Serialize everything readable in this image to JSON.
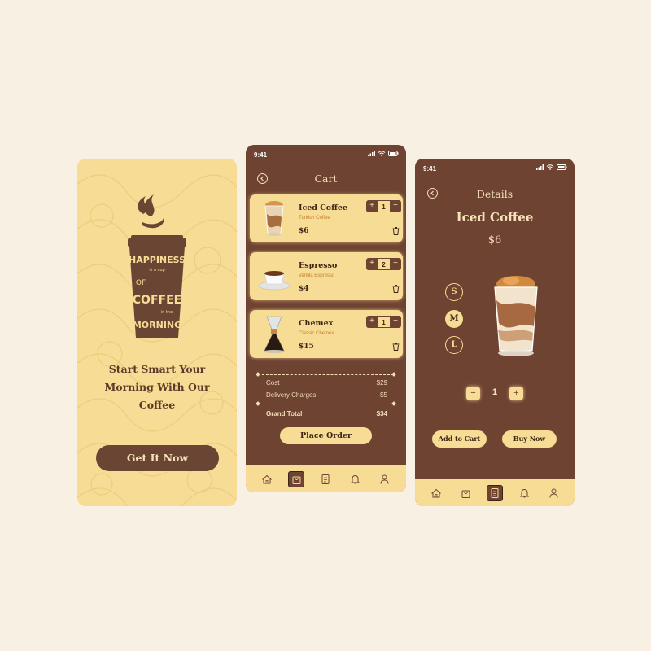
{
  "splash": {
    "logo_words": [
      "HAPPINESS",
      "is a cup",
      "OF",
      "COFFEE",
      "in the",
      "MORNING"
    ],
    "headline": [
      "Start Smart Your",
      "Morning With Our",
      "Coffee"
    ],
    "cta_label": "Get It Now"
  },
  "cart": {
    "status_time": "9:41",
    "title": "Cart",
    "items": [
      {
        "name": "Iced Coffee",
        "variant": "Turkish Coffee",
        "price": "$6",
        "qty": "1"
      },
      {
        "name": "Espresso",
        "variant": "Vanilla Espresso",
        "price": "$4",
        "qty": "2"
      },
      {
        "name": "Chemex",
        "variant": "Classic Chemex",
        "price": "$15",
        "qty": "1"
      }
    ],
    "summary": {
      "cost_label": "Cost",
      "cost_value": "$29",
      "delivery_label": "Delivery Charges",
      "delivery_value": "$5",
      "grand_label": "Grand Total",
      "grand_value": "$34"
    },
    "place_order_label": "Place Order",
    "tabs": [
      "home",
      "cart",
      "orders",
      "notifications",
      "profile"
    ],
    "active_tab": "cart"
  },
  "details": {
    "status_time": "9:41",
    "title": "Details",
    "product_name": "Iced Coffee",
    "product_price": "$6",
    "sizes": [
      "S",
      "M",
      "L"
    ],
    "selected_size": "M",
    "quantity": "1",
    "minus_label": "−",
    "plus_label": "+",
    "add_to_cart_label": "Add to Cart",
    "buy_now_label": "Buy Now",
    "tabs": [
      "home",
      "cart",
      "orders",
      "notifications",
      "profile"
    ],
    "active_tab": "orders"
  },
  "colors": {
    "background": "#f8f0e2",
    "brown": "#6e4332",
    "cream": "#f6dc94",
    "accent_text": "#c87c2f"
  },
  "icons": [
    "back-arrow-icon",
    "trash-icon",
    "home-icon",
    "bag-icon",
    "document-icon",
    "bell-icon",
    "user-icon",
    "signal-icon",
    "wifi-icon",
    "battery-icon"
  ]
}
